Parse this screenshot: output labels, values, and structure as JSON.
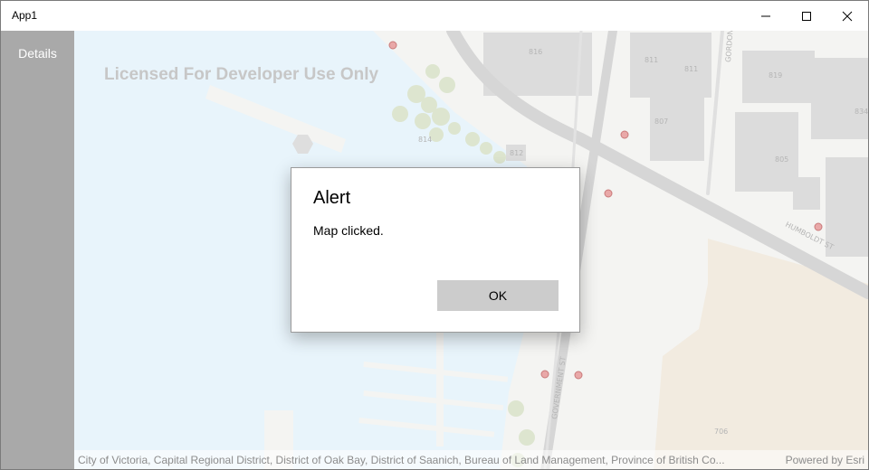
{
  "window": {
    "title": "App1",
    "controls": [
      "minimize-icon",
      "maximize-icon",
      "close-icon"
    ]
  },
  "sidepane": {
    "details_label": "Details"
  },
  "map": {
    "watermark": "Licensed For Developer Use Only",
    "attribution": "City of Victoria, Capital Regional District, District of Oak Bay, District of Saanich, Bureau of Land Management, Province of British Co...",
    "powered_by": "Powered by Esri",
    "labels": {
      "b816": "816",
      "b814": "814",
      "b812": "812",
      "b811a": "811",
      "b811b": "811",
      "b807": "807",
      "b819": "819",
      "b805": "805",
      "b834": "834",
      "b706": "706",
      "street_humboldt": "HUMBOLDT ST",
      "street_government": "GOVERNMENT ST",
      "street_gordon": "GORDON"
    },
    "colors": {
      "water": "#e8f4fb",
      "land": "#f4f4f2",
      "building": "#dcdcdc",
      "park": "#f2ebe0",
      "road": "#d4d4d4",
      "poi": "#e9a8a8"
    }
  },
  "dialog": {
    "title": "Alert",
    "message": "Map clicked.",
    "ok_label": "OK"
  }
}
